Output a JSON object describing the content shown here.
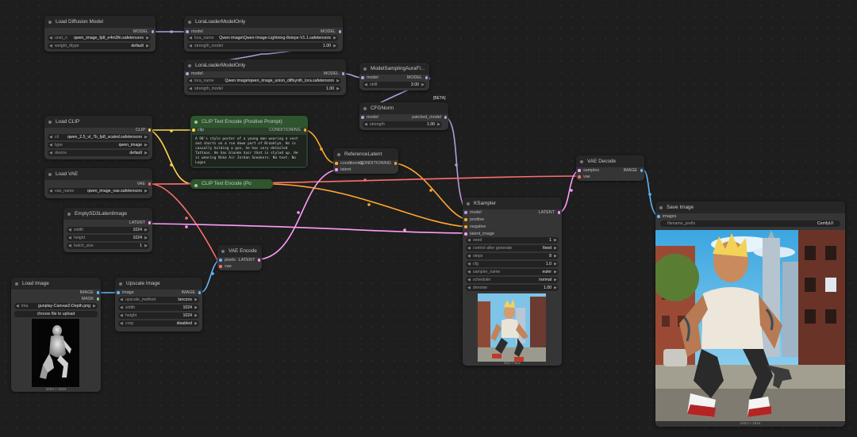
{
  "colors": {
    "model": "#b39ddb",
    "clip": "#ffd54f",
    "vae": "#ff6e6e",
    "latent": "#ff9cf9",
    "conditioning": "#ffa931",
    "image": "#64b5f6",
    "mask": "#81c784"
  },
  "nodes": {
    "load_diffusion": {
      "title": "Load Diffusion Model",
      "out_model": "MODEL",
      "w1_label": "unet_n",
      "w1_value": "qwen_image_fp8_e4m3fn.safetensors",
      "w2_label": "weight_dtype",
      "w2_value": "default"
    },
    "lora1": {
      "title": "LoraLoaderModelOnly",
      "in_model": "model",
      "out_model": "MODEL",
      "w1_label": "lora_name",
      "w1_value": "Qwen image\\Qwen-Image-Lightning-8steps-V1.1.safetensors",
      "w2_label": "strength_model",
      "w2_value": "1.00"
    },
    "lora2": {
      "title": "LoraLoaderModelOnly",
      "in_model": "model",
      "out_model": "MODEL",
      "w1_label": "lora_name",
      "w1_value": "Qwen image\\qwen_image_union_diffsynth_lora.safetensors",
      "w2_label": "strength_model",
      "w2_value": "1.00"
    },
    "msaura": {
      "title": "ModelSamplingAuraFl...",
      "in_model": "model",
      "out_model": "MODEL",
      "w1_label": "shift",
      "w1_value": "3.00"
    },
    "cfgnorm": {
      "title": "CFGNorm",
      "beta": "[BETA]",
      "in_model": "model",
      "out_model": "patched_model",
      "w1_label": "strength",
      "w1_value": "1.00"
    },
    "load_clip": {
      "title": "Load CLIP",
      "out_clip": "CLIP",
      "w1_label": "cli",
      "w1_value": "qwen_2.5_vl_7b_fp8_scaled.safetensors",
      "w2_label": "type",
      "w2_value": "qwen_image",
      "w3_label": "device",
      "w3_value": "default"
    },
    "clip_pos": {
      "title": "CLIP Text Encode (Positive Prompt)",
      "in_clip": "clip",
      "out_cond": "CONDITIONING",
      "text": "A 90's style poster of a young man wearing a vest and shorts on a run down part of Brooklyn. He is casually holding a gun, he has very detailed Tattoos. He has blonde hair that is styled up. He is wearing Nike Air Jordan Sneakers. No text. No Logos"
    },
    "clip_neg": {
      "title": "CLIP Text Encode (Po"
    },
    "reflatent": {
      "title": "ReferenceLatent",
      "in_cond": "conditioning",
      "in_latent": "latent",
      "out_cond": "CONDITIONING"
    },
    "load_vae": {
      "title": "Load VAE",
      "out_vae": "VAE",
      "w1_label": "vae_name",
      "w1_value": "qwen_image_vae.safetensors"
    },
    "empty_latent": {
      "title": "EmptySD3LatentImage",
      "out_latent": "LATENT",
      "w1_label": "width",
      "w1_value": "1024",
      "w2_label": "height",
      "w2_value": "1024",
      "w3_label": "batch_size",
      "w3_value": "1"
    },
    "vae_encode": {
      "title": "VAE Encode",
      "in_pixels": "pixels",
      "in_vae": "vae",
      "out_latent": "LATENT"
    },
    "load_image": {
      "title": "Load Image",
      "out_image": "IMAGE",
      "out_mask": "MASK",
      "w1_label": "ima",
      "w1_value": "gunplay-Canvas2-Depth.png",
      "upload": "choose file to upload",
      "caption": "1024 × 1024"
    },
    "upscale": {
      "title": "Upscale Image",
      "in_image": "image",
      "out_image": "IMAGE",
      "w1_label": "upscale_method",
      "w1_value": "lanczos",
      "w2_label": "width",
      "w2_value": "1024",
      "w3_label": "height",
      "w3_value": "1024",
      "w4_label": "crop",
      "w4_value": "disabled"
    },
    "ksampler": {
      "title": "KSampler",
      "in_model": "model",
      "in_pos": "positive",
      "in_neg": "negative",
      "in_latent": "latent_image",
      "out_latent": "LATENT",
      "w1_label": "seed",
      "w1_value": "1",
      "w2_label": "control after generate",
      "w2_value": "fixed",
      "w3_label": "steps",
      "w3_value": "8",
      "w4_label": "cfg",
      "w4_value": "1.0",
      "w5_label": "sampler_name",
      "w5_value": "euler",
      "w6_label": "scheduler",
      "w6_value": "normal",
      "w7_label": "denoise",
      "w7_value": "1.00",
      "caption": "512 × 512"
    },
    "vae_decode": {
      "title": "VAE Decode",
      "in_samples": "samples",
      "in_vae": "vae",
      "out_image": "IMAGE"
    },
    "save_image": {
      "title": "Save Image",
      "in_images": "images",
      "w1_label": "filename_prefix",
      "w1_value": "ComfyUI",
      "caption": "1024 × 1024"
    }
  }
}
